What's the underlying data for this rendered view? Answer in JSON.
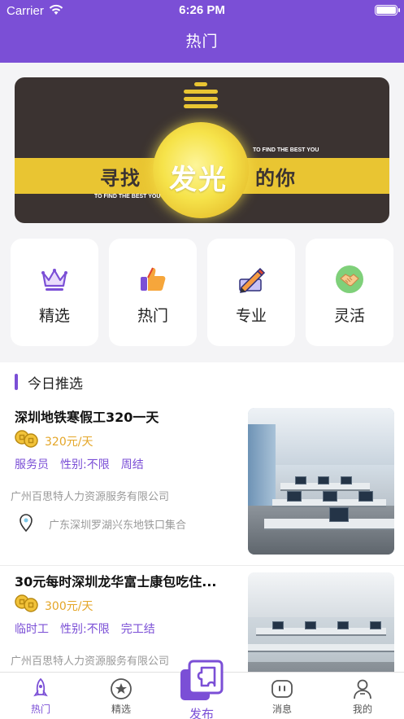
{
  "status_bar": {
    "carrier": "Carrier",
    "time": "6:26 PM"
  },
  "nav": {
    "title": "热门"
  },
  "banner": {
    "text_left": "寻找",
    "text_mid": "发光",
    "text_right": "的你",
    "tagline_top": "TO FIND THE BEST YOU",
    "tagline_bottom": "TO FIND THE BEST YOU"
  },
  "categories": [
    {
      "label": "精选",
      "icon": "crown-icon"
    },
    {
      "label": "热门",
      "icon": "thumbs-up-icon"
    },
    {
      "label": "专业",
      "icon": "pencil-icon"
    },
    {
      "label": "灵活",
      "icon": "handshake-icon"
    }
  ],
  "section": {
    "title": "今日推选"
  },
  "jobs": [
    {
      "title": "深圳地铁寒假工320一天",
      "salary": "320元/天",
      "tags": [
        "服务员",
        "性别:不限",
        "周结"
      ],
      "company": "广州百思特人力资源服务有限公司",
      "address": "广东深圳罗湖兴东地铁口集合"
    },
    {
      "title": "30元每时深圳龙华富士康包吃住...",
      "salary": "300元/天",
      "tags": [
        "临时工",
        "性别:不限",
        "完工结"
      ],
      "company": "广州百思特人力资源服务有限公司"
    }
  ],
  "tabbar": {
    "tabs": [
      {
        "label": "热门",
        "icon": "rocket-icon",
        "active": true
      },
      {
        "label": "精选",
        "icon": "star-circle-icon",
        "active": false
      },
      {
        "label": "消息",
        "icon": "message-icon",
        "active": false
      },
      {
        "label": "我的",
        "icon": "user-icon",
        "active": false
      }
    ],
    "publish_label": "发布"
  },
  "colors": {
    "accent": "#7b4fd6",
    "salary": "#e4a628",
    "banner_dark": "#3b3331",
    "banner_yellow": "#e9c532"
  }
}
